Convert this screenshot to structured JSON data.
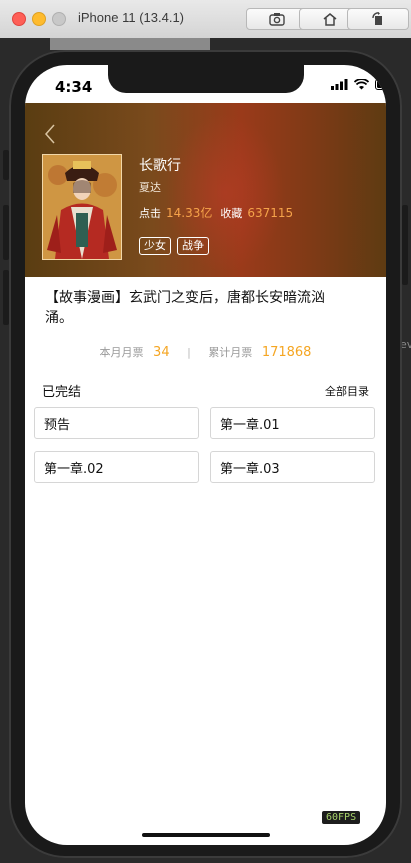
{
  "simulator": {
    "title": "iPhone 11 (13.4.1)",
    "buttons": [
      "screenshot-icon",
      "home-icon",
      "rotate-icon"
    ]
  },
  "status_bar": {
    "time": "4:34"
  },
  "comic": {
    "title": "长歌行",
    "author": "夏达",
    "clicks_label": "点击",
    "clicks": "14.33亿",
    "favorites_label": "收藏",
    "favorites": "637115",
    "tags": [
      "少女",
      "战争"
    ],
    "description": "【故事漫画】玄武门之变后，唐都长安暗流汹涌。"
  },
  "tickets": {
    "monthly_label": "本月月票",
    "monthly": "34",
    "total_label": "累计月票",
    "total": "171868"
  },
  "chapters": {
    "status": "已完结",
    "all_toc": "全部目录",
    "items": [
      "预告",
      "第一章.01",
      "第一章.02",
      "第一章.03"
    ]
  },
  "fps": "60FPS",
  "colors": {
    "accent": "#f5a623",
    "header": "#7a4a1c"
  }
}
